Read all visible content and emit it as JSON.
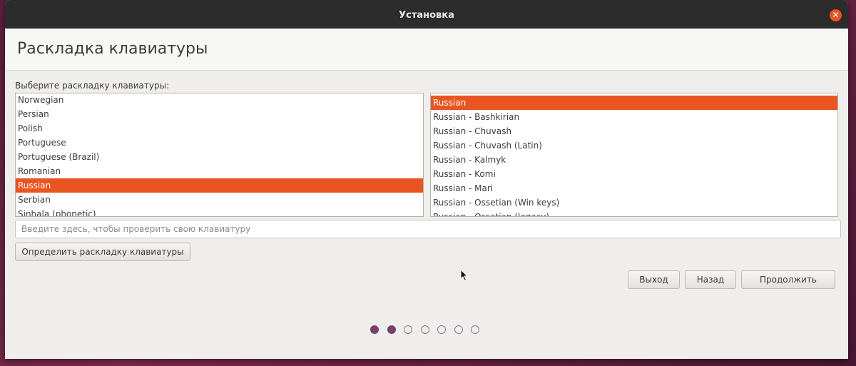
{
  "window": {
    "title": "Установка"
  },
  "page": {
    "title": "Раскладка клавиатуры",
    "prompt": "Выберите раскладку клавиатуры:"
  },
  "layouts": {
    "items": [
      "Norwegian",
      "Persian",
      "Polish",
      "Portuguese",
      "Portuguese (Brazil)",
      "Romanian",
      "Russian",
      "Serbian",
      "Sinhala (phonetic)"
    ],
    "selected": "Russian"
  },
  "variants": {
    "items": [
      "Russian",
      "Russian - Bashkirian",
      "Russian - Chuvash",
      "Russian - Chuvash (Latin)",
      "Russian - Kalmyk",
      "Russian - Komi",
      "Russian - Mari",
      "Russian - Ossetian (Win keys)",
      "Russian - Ossetian (legacy)"
    ],
    "selected": "Russian"
  },
  "test_field": {
    "placeholder": "Введите здесь, чтобы проверить свою клавиатуру",
    "value": ""
  },
  "buttons": {
    "detect": "Определить раскладку клавиатуры",
    "quit": "Выход",
    "back": "Назад",
    "continue": "Продолжить"
  },
  "progress": {
    "total_steps": 7,
    "completed_steps": 2
  },
  "colors": {
    "accent": "#e95420",
    "progress_dot": "#77416b",
    "titlebar": "#2c2c2c"
  }
}
